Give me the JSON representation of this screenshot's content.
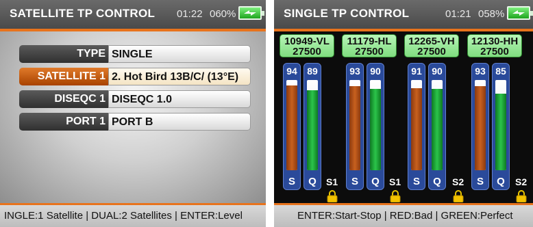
{
  "left": {
    "header": {
      "title": "SATELLITE TP CONTROL",
      "time": "01:22",
      "battery_pct": "060%"
    },
    "rows": [
      {
        "label": "TYPE",
        "value": "SINGLE",
        "selected": false
      },
      {
        "label": "SATELLITE 1",
        "value": "2. Hot Bird 13B/C/ (13°E)",
        "selected": true
      },
      {
        "label": "DISEQC 1",
        "value": "DISEQC 1.0",
        "selected": false
      },
      {
        "label": "PORT 1",
        "value": "PORT B",
        "selected": false
      }
    ],
    "footer": "INGLE:1 Satellite | DUAL:2 Satellites | ENTER:Level"
  },
  "right": {
    "header": {
      "title": "SINGLE TP CONTROL",
      "time": "01:21",
      "battery_pct": "058%"
    },
    "transponders": [
      {
        "freq": "10949-VL",
        "sr": "27500",
        "s": 94,
        "q": 89,
        "sat": "S1"
      },
      {
        "freq": "11179-HL",
        "sr": "27500",
        "s": 93,
        "q": 90,
        "sat": "S1"
      },
      {
        "freq": "12265-VH",
        "sr": "27500",
        "s": 91,
        "q": 90,
        "sat": "S2"
      },
      {
        "freq": "12130-HH",
        "sr": "27500",
        "s": 93,
        "q": 85,
        "sat": "S2"
      }
    ],
    "bar_letters": {
      "s": "S",
      "q": "Q"
    },
    "footer": "ENTER:Start-Stop | RED:Bad | GREEN:Perfect"
  },
  "colors": {
    "accent": "#e8731c",
    "signal": "#c8601e",
    "quality": "#2bc44a",
    "tp_box": "#7fdc7f"
  },
  "icons": {
    "battery": "battery-charging-icon",
    "lock": "padlock-icon"
  }
}
